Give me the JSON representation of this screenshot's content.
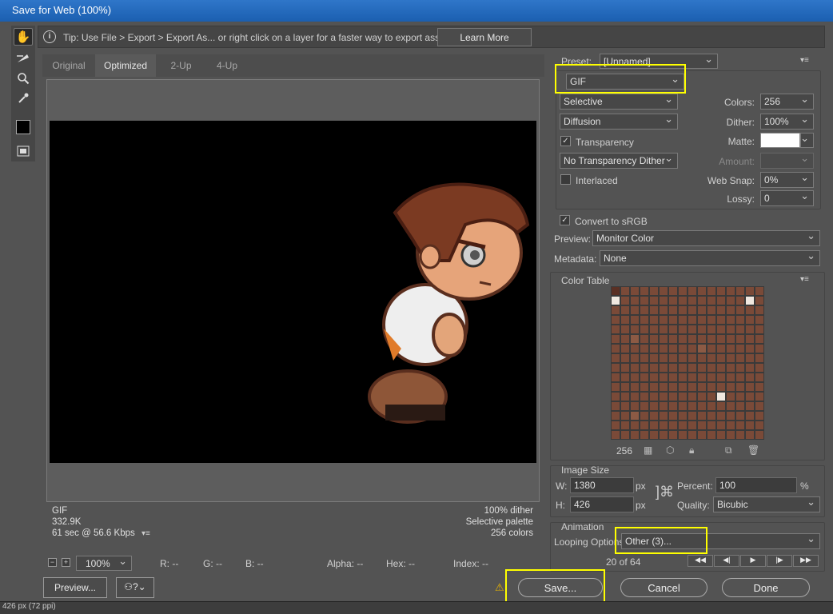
{
  "window": {
    "title": "Save for Web (100%)"
  },
  "tip": {
    "text": "Tip: Use File > Export > Export As...  or right click on a layer for a faster way to export assets",
    "learn_more": "Learn More"
  },
  "tabs": [
    {
      "label": "Original"
    },
    {
      "label": "Optimized"
    },
    {
      "label": "2-Up"
    },
    {
      "label": "4-Up"
    }
  ],
  "image_info": {
    "format": "GIF",
    "size": "332.9K",
    "time": "61 sec @ 56.6 Kbps",
    "dither": "100% dither",
    "palette": "Selective palette",
    "colors": "256 colors"
  },
  "bottom_bar": {
    "zoom": "100%",
    "r": "R: --",
    "g": "G: --",
    "b": "B: --",
    "alpha": "Alpha: --",
    "hex": "Hex: --",
    "index": "Index: --"
  },
  "settings": {
    "preset_label": "Preset:",
    "preset_value": "[Unnamed]",
    "format": "GIF",
    "reduction": "Selective",
    "colors_label": "Colors:",
    "colors_value": "256",
    "dither_algo": "Diffusion",
    "dither_label": "Dither:",
    "dither_value": "100%",
    "transparency_label": "Transparency",
    "matte_label": "Matte:",
    "transparency_dither": "No Transparency Dither",
    "amount_label": "Amount:",
    "interlaced_label": "Interlaced",
    "websnap_label": "Web Snap:",
    "websnap_value": "0%",
    "lossy_label": "Lossy:",
    "lossy_value": "0",
    "convert_srgb_label": "Convert to sRGB",
    "preview_label": "Preview:",
    "preview_value": "Monitor Color",
    "metadata_label": "Metadata:",
    "metadata_value": "None"
  },
  "color_table": {
    "title": "Color Table",
    "count": "256"
  },
  "image_size": {
    "title": "Image Size",
    "w_label": "W:",
    "w_value": "1380",
    "h_label": "H:",
    "h_value": "426",
    "unit": "px",
    "percent_label": "Percent:",
    "percent_value": "100",
    "percent_unit": "%",
    "quality_label": "Quality:",
    "quality_value": "Bicubic"
  },
  "animation": {
    "title": "Animation",
    "looping_label": "Looping Options:",
    "looping_value": "Other (3)...",
    "frame_counter": "20 of 64"
  },
  "footer": {
    "preview": "Preview...",
    "save": "Save...",
    "cancel": "Cancel",
    "done": "Done"
  },
  "status": {
    "text": "426 px (72 ppi)"
  },
  "colors": {
    "highlight": "#ffff00",
    "title_bar": "#1b5fb0"
  }
}
